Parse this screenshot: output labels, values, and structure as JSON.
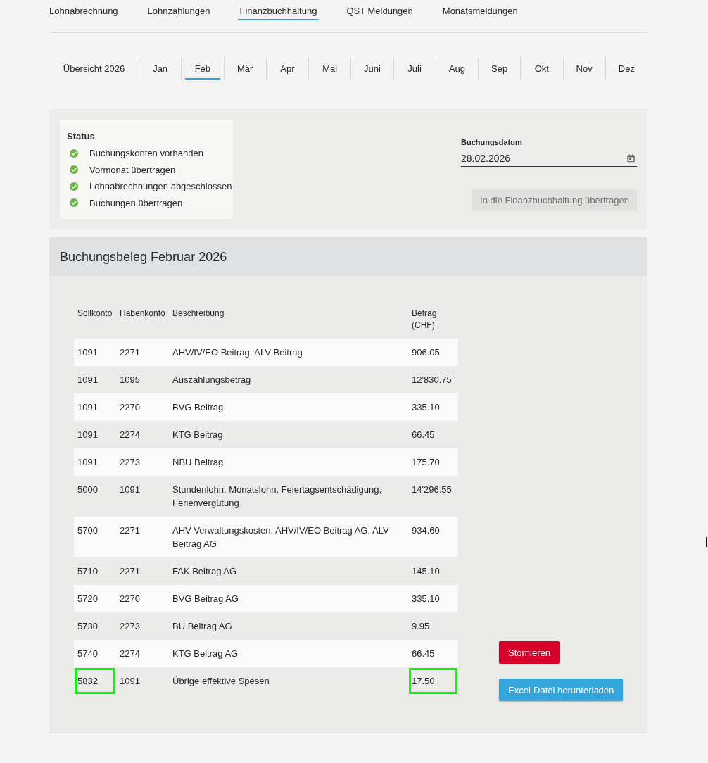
{
  "main_tabs": [
    {
      "label": "Lohnabrechnung",
      "selected": false
    },
    {
      "label": "Lohnzahlungen",
      "selected": false
    },
    {
      "label": "Finanzbuchhaltung",
      "selected": true
    },
    {
      "label": "QST Meldungen",
      "selected": false
    },
    {
      "label": "Monatsmeldungen",
      "selected": false
    }
  ],
  "month_tabs": [
    {
      "label": "Übersicht 2026",
      "selected": false
    },
    {
      "label": "Jan",
      "selected": false
    },
    {
      "label": "Feb",
      "selected": true
    },
    {
      "label": "Mär",
      "selected": false
    },
    {
      "label": "Apr",
      "selected": false
    },
    {
      "label": "Mai",
      "selected": false
    },
    {
      "label": "Juni",
      "selected": false
    },
    {
      "label": "Juli",
      "selected": false
    },
    {
      "label": "Aug",
      "selected": false
    },
    {
      "label": "Sep",
      "selected": false
    },
    {
      "label": "Okt",
      "selected": false
    },
    {
      "label": "Nov",
      "selected": false
    },
    {
      "label": "Dez",
      "selected": false
    }
  ],
  "status": {
    "title": "Status",
    "items": [
      {
        "label": "Buchungskonten vorhanden",
        "done": true
      },
      {
        "label": "Vormonat übertragen",
        "done": true
      },
      {
        "label": "Lohnabrechnungen abgeschlossen",
        "done": true
      },
      {
        "label": "Buchungen übertragen",
        "done": true
      }
    ]
  },
  "booking_date": {
    "label": "Buchungsdatum",
    "value": "28.02.2026"
  },
  "transfer_button": {
    "label": "In die Finanzbuchhaltung übertragen",
    "disabled": true
  },
  "voucher": {
    "title": "Buchungsbeleg Februar 2026",
    "columns": [
      "Sollkonto",
      "Habenkonto",
      "Beschreibung",
      "Betrag (CHF)"
    ],
    "rows": [
      {
        "cells": [
          {
            "text": "1091",
            "highlighted": false
          },
          {
            "text": "2271",
            "highlighted": false
          },
          {
            "text": "AHV/IV/EO Beitrag, ALV Beitrag",
            "highlighted": false
          },
          {
            "text": "906.05",
            "highlighted": false
          }
        ]
      },
      {
        "cells": [
          {
            "text": "1091",
            "highlighted": false
          },
          {
            "text": "1095",
            "highlighted": false
          },
          {
            "text": "Auszahlungsbetrag",
            "highlighted": false
          },
          {
            "text": "12'830.75",
            "highlighted": false
          }
        ]
      },
      {
        "cells": [
          {
            "text": "1091",
            "highlighted": false
          },
          {
            "text": "2270",
            "highlighted": false
          },
          {
            "text": "BVG Beitrag",
            "highlighted": false
          },
          {
            "text": "335.10",
            "highlighted": false
          }
        ]
      },
      {
        "cells": [
          {
            "text": "1091",
            "highlighted": false
          },
          {
            "text": "2274",
            "highlighted": false
          },
          {
            "text": "KTG Beitrag",
            "highlighted": false
          },
          {
            "text": "66.45",
            "highlighted": false
          }
        ]
      },
      {
        "cells": [
          {
            "text": "1091",
            "highlighted": false
          },
          {
            "text": "2273",
            "highlighted": false
          },
          {
            "text": "NBU Beitrag",
            "highlighted": false
          },
          {
            "text": "175.70",
            "highlighted": false
          }
        ]
      },
      {
        "cells": [
          {
            "text": "5000",
            "highlighted": false
          },
          {
            "text": "1091",
            "highlighted": false
          },
          {
            "text": "Stundenlohn, Monatslohn, Feiertagsentschädigung, Ferienvergütung",
            "highlighted": false
          },
          {
            "text": "14'296.55",
            "highlighted": false
          }
        ]
      },
      {
        "cells": [
          {
            "text": "5700",
            "highlighted": false
          },
          {
            "text": "2271",
            "highlighted": false
          },
          {
            "text": "AHV Verwaltungskosten, AHV/IV/EO Beitrag AG, ALV Beitrag AG",
            "highlighted": false
          },
          {
            "text": "934.60",
            "highlighted": false
          }
        ]
      },
      {
        "cells": [
          {
            "text": "5710",
            "highlighted": false
          },
          {
            "text": "2271",
            "highlighted": false
          },
          {
            "text": "FAK Beitrag AG",
            "highlighted": false
          },
          {
            "text": "145.10",
            "highlighted": false
          }
        ]
      },
      {
        "cells": [
          {
            "text": "5720",
            "highlighted": false
          },
          {
            "text": "2270",
            "highlighted": false
          },
          {
            "text": "BVG Beitrag AG",
            "highlighted": false
          },
          {
            "text": "335.10",
            "highlighted": false
          }
        ]
      },
      {
        "cells": [
          {
            "text": "5730",
            "highlighted": false
          },
          {
            "text": "2273",
            "highlighted": false
          },
          {
            "text": "BU Beitrag AG",
            "highlighted": false
          },
          {
            "text": "9.95",
            "highlighted": false
          }
        ]
      },
      {
        "cells": [
          {
            "text": "5740",
            "highlighted": false
          },
          {
            "text": "2274",
            "highlighted": false
          },
          {
            "text": "KTG Beitrag AG",
            "highlighted": false
          },
          {
            "text": "66.45",
            "highlighted": false
          }
        ]
      },
      {
        "cells": [
          {
            "text": "5832",
            "highlighted": true
          },
          {
            "text": "1091",
            "highlighted": false
          },
          {
            "text": "Übrige effektive Spesen",
            "highlighted": false
          },
          {
            "text": "17.50",
            "highlighted": true
          }
        ]
      }
    ]
  },
  "actions": [
    {
      "label": "Stornieren",
      "kind": "danger"
    },
    {
      "label": "Excel-Datei herunterladen",
      "kind": "primary"
    }
  ]
}
